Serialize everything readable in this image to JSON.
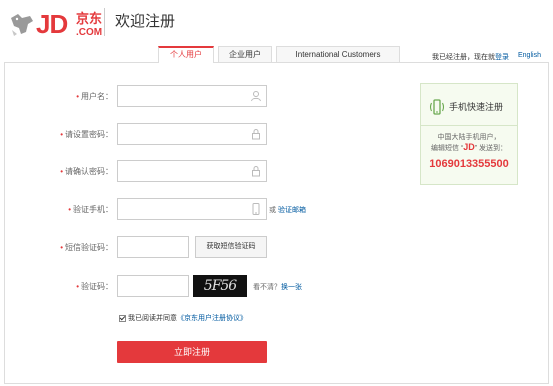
{
  "header": {
    "logo_jd": "JD",
    "logo_cn": "京东",
    "logo_com": ".COM",
    "title": "欢迎注册"
  },
  "tabs": [
    {
      "label": "个人用户",
      "active": true
    },
    {
      "label": "企业用户",
      "active": false
    },
    {
      "label": "International Customers",
      "active": false
    }
  ],
  "top_right": {
    "prompt": "我已经注册，现在就",
    "login": "登录",
    "english": "English"
  },
  "form": {
    "username_label": "用户名：",
    "password_label": "请设置密码：",
    "confirm_label": "请确认密码：",
    "phone_label": "验证手机：",
    "phone_alt_prefix": "或",
    "phone_alt_link": "验证邮箱",
    "sms_label": "短信验证码：",
    "sms_button": "获取短信验证码",
    "captcha_label": "验证码：",
    "captcha_text": "5F56",
    "captcha_help": "看不清？",
    "captcha_refresh": "换一张",
    "agree_text": "我已阅读并同意",
    "agree_link": "《京东用户注册协议》",
    "submit": "立即注册"
  },
  "promo": {
    "title": "手机快速注册",
    "line1": "中国大陆手机用户，",
    "line2_prefix": "编辑短信 “",
    "line2_jd": "JD",
    "line2_suffix": "” 发送到：",
    "number": "1069013355500"
  },
  "colors": {
    "brand_red": "#e4393c",
    "link_blue": "#005aa0"
  }
}
